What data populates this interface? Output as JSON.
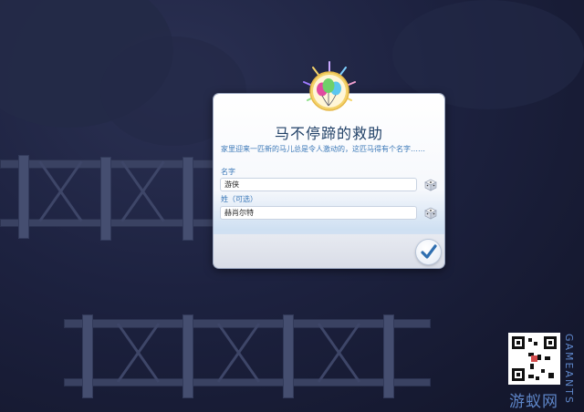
{
  "dialog": {
    "title": "马不停蹄的救助",
    "description": "家里迎来一匹新的马儿总是令人激动的，这匹马得有个名字……",
    "first_name": {
      "label": "名字",
      "value": "游侠"
    },
    "last_name": {
      "label": "姓（可选）",
      "value": "赫肖尔特"
    }
  },
  "watermark": {
    "side_text": "GAMEANTS",
    "bottom_text": "游蚁网"
  },
  "colors": {
    "title": "#1f3f66",
    "label": "#3b78b8",
    "accent": "#2f6fb0"
  }
}
